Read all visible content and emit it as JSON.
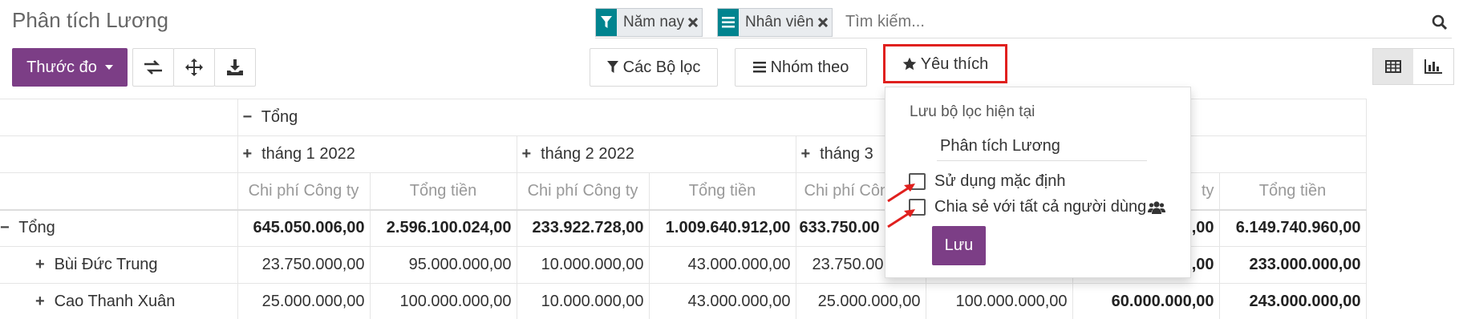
{
  "app": {
    "title": "Phân tích Lương"
  },
  "search": {
    "facets": [
      {
        "label": "Năm nay",
        "icon": "filter-icon",
        "color": "#01848f"
      },
      {
        "label": "Nhân viên",
        "icon": "group-list-icon",
        "color": "#01848f"
      }
    ],
    "placeholder": "Tìm kiếm..."
  },
  "toolbar": {
    "measures_label": "Thước đo",
    "filters_label": "Các Bộ lọc",
    "groupby_label": "Nhóm theo",
    "favorites_label": "Yêu thích"
  },
  "colors": {
    "primary": "#7c3e86",
    "facet": "#01848f",
    "highlight": "#e0201e"
  },
  "pivot": {
    "total_header": "Tổng",
    "months": [
      "tháng 1 2022",
      "tháng 2 2022",
      "tháng 3"
    ],
    "measures": [
      "Chi phí Công ty",
      "Tổng tiền",
      "Chi phí Công ty",
      "Tổng tiền",
      "Chi phí Công",
      "ty",
      "Tổng tiền"
    ],
    "rows": [
      {
        "label": "Tổng",
        "values": [
          "645.050.006,00",
          "2.596.100.024,00",
          "233.922.728,00",
          "1.009.640.912,00",
          "633.750.00",
          ",00",
          "6.149.740.960,00"
        ]
      },
      {
        "label": "Bùi Đức Trung",
        "values": [
          "23.750.000,00",
          "95.000.000,00",
          "10.000.000,00",
          "43.000.000,00",
          "23.750.00",
          ",00",
          "233.000.000,00"
        ]
      },
      {
        "label": "Cao Thanh Xuân",
        "values": [
          "25.000.000,00",
          "100.000.000,00",
          "10.000.000,00",
          "43.000.000,00",
          "25.000.000,00",
          "100.000.000,00",
          "60.000.000,00",
          "243.000.000,00"
        ]
      }
    ]
  },
  "favorites_menu": {
    "save_current_label": "Lưu bộ lọc hiện tại",
    "filter_name": "Phân tích Lương",
    "use_default_label": "Sử dụng mặc định",
    "share_label": "Chia sẻ với tất cả người dùng",
    "save_button": "Lưu"
  }
}
